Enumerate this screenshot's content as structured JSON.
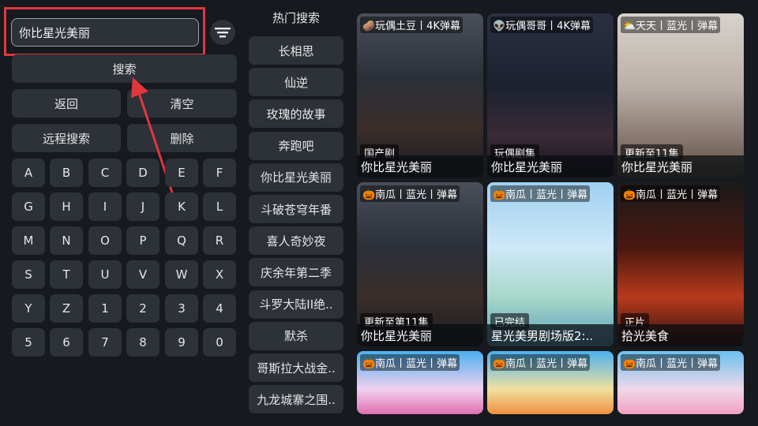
{
  "search": {
    "value": "你比星光美丽",
    "button_label": "搜索"
  },
  "actions": {
    "back": "返回",
    "clear": "清空",
    "remote_search": "远程搜索",
    "delete": "删除"
  },
  "keyboard": {
    "rows": [
      [
        "A",
        "B",
        "C",
        "D",
        "E",
        "F"
      ],
      [
        "G",
        "H",
        "I",
        "J",
        "K",
        "L"
      ],
      [
        "M",
        "N",
        "O",
        "P",
        "Q",
        "R"
      ],
      [
        "S",
        "T",
        "U",
        "V",
        "W",
        "X"
      ],
      [
        "Y",
        "Z",
        "1",
        "2",
        "3",
        "4"
      ],
      [
        "5",
        "6",
        "7",
        "8",
        "9",
        "0"
      ]
    ]
  },
  "hot": {
    "title": "热门搜索",
    "items": [
      "长相思",
      "仙逆",
      "玫瑰的故事",
      "奔跑吧",
      "你比星光美丽",
      "斗破苍穹年番",
      "喜人奇妙夜",
      "庆余年第二季",
      "斗罗大陆II绝..",
      "默杀",
      "哥斯拉大战金..",
      "九龙城寨之围.."
    ]
  },
  "results": [
    {
      "badge": "🥔玩偶土豆丨4K弹幕",
      "tag": "国产剧",
      "title": "你比星光美丽"
    },
    {
      "badge": "👽玩偶哥哥丨4K弹幕",
      "tag": "玩偶剧集",
      "title": "你比星光美丽"
    },
    {
      "badge": "⛅天天丨蓝光丨弹幕",
      "tag": "更新至11集",
      "title": "你比星光美丽"
    },
    {
      "badge": "🎃南瓜丨蓝光丨弹幕",
      "tag": "更新至第11集",
      "title": "你比星光美丽"
    },
    {
      "badge": "🎃南瓜丨蓝光丨弹幕",
      "tag": "已完结",
      "title": "星光美男剧场版2:.."
    },
    {
      "badge": "🎃南瓜丨蓝光丨弹幕",
      "tag": "正片",
      "title": "拾光美食"
    },
    {
      "badge": "🎃南瓜丨蓝光丨弹幕",
      "tag": "",
      "title": ""
    },
    {
      "badge": "🎃南瓜丨蓝光丨弹幕",
      "tag": "",
      "title": ""
    },
    {
      "badge": "🎃南瓜丨蓝光丨弹幕",
      "tag": "",
      "title": ""
    }
  ],
  "colors": {
    "highlight": "#e0373f",
    "button_bg": "#2d3138",
    "page_bg": "#16191e"
  }
}
